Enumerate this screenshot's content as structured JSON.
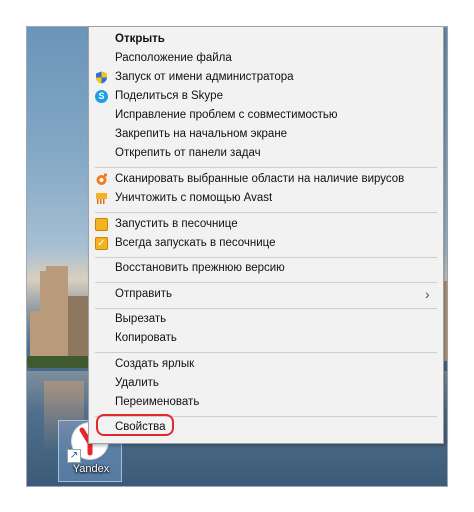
{
  "context_menu": {
    "items": [
      {
        "label": "Открыть"
      },
      {
        "label": "Расположение файла"
      },
      {
        "label": "Запуск от имени администратора"
      },
      {
        "label": "Поделиться в Skype"
      },
      {
        "label": "Исправление проблем с совместимостью"
      },
      {
        "label": "Закрепить на начальном экране"
      },
      {
        "label": "Открепить от панели задач"
      },
      {
        "label": "Сканировать выбранные области на наличие вирусов"
      },
      {
        "label": "Уничтожить с помощью Avast"
      },
      {
        "label": "Запустить в песочнице"
      },
      {
        "label": "Всегда запускать в песочнице"
      },
      {
        "label": "Восстановить прежнюю версию"
      },
      {
        "label": "Отправить"
      },
      {
        "label": "Вырезать"
      },
      {
        "label": "Копировать"
      },
      {
        "label": "Создать ярлык"
      },
      {
        "label": "Удалить"
      },
      {
        "label": "Переименовать"
      },
      {
        "label": "Свойства"
      }
    ],
    "highlighted_item": "Свойства",
    "highlight_color": "#e02a2a"
  },
  "desktop_icon": {
    "label": "Yandex",
    "icon": "yandex-browser-icon"
  },
  "icons": {
    "admin": "uac-shield-icon",
    "skype": "skype-icon",
    "avast_scan": "avast-icon",
    "avast_destroy": "avast-shredder-icon",
    "sandbox_run": "sandbox-icon",
    "sandbox_always": "sandbox-check-icon",
    "send_to_arrow": "chevron-right-icon"
  }
}
